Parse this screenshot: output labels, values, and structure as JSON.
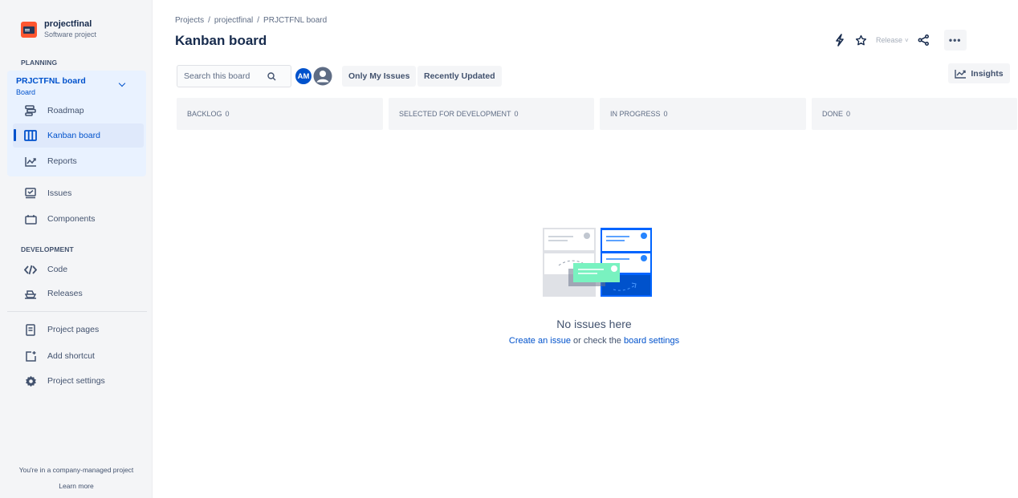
{
  "project": {
    "name": "projectfinal",
    "type": "Software project"
  },
  "sidebar": {
    "planning_label": "PLANNING",
    "board": {
      "title": "PRJCTFNL board",
      "subtitle": "Board"
    },
    "board_items": [
      {
        "label": "Roadmap",
        "icon": "roadmap-icon"
      },
      {
        "label": "Kanban board",
        "icon": "kanban-board-icon",
        "active": true
      },
      {
        "label": "Reports",
        "icon": "reports-icon"
      }
    ],
    "items": [
      {
        "label": "Issues",
        "icon": "issues-icon"
      },
      {
        "label": "Components",
        "icon": "components-icon"
      }
    ],
    "development_label": "DEVELOPMENT",
    "dev_items": [
      {
        "label": "Code",
        "icon": "code-icon"
      },
      {
        "label": "Releases",
        "icon": "releases-icon"
      }
    ],
    "bottom_items": [
      {
        "label": "Project pages",
        "icon": "project-pages-icon"
      },
      {
        "label": "Add shortcut",
        "icon": "add-shortcut-icon"
      },
      {
        "label": "Project settings",
        "icon": "gear-icon"
      }
    ],
    "footer": {
      "text": "You're in a company-managed project",
      "link": "Learn more"
    }
  },
  "breadcrumb": [
    "Projects",
    "/",
    "projectfinal",
    "/",
    "PRJCTFNL board"
  ],
  "page_title": "Kanban board",
  "header": {
    "release_label": "Release"
  },
  "toolbar": {
    "search_placeholder": "Search this board",
    "avatar_initials": "AM",
    "filters": [
      "Only My Issues",
      "Recently Updated"
    ],
    "insights_label": "Insights"
  },
  "columns": [
    {
      "name": "BACKLOG",
      "count": "0"
    },
    {
      "name": "SELECTED FOR DEVELOPMENT",
      "count": "0"
    },
    {
      "name": "IN PROGRESS",
      "count": "0"
    },
    {
      "name": "DONE",
      "count": "0"
    }
  ],
  "empty_state": {
    "title": "No issues here",
    "create_link": "Create an issue",
    "middle_text": " or check the ",
    "settings_link": "board settings"
  },
  "colors": {
    "accent": "#0052cc",
    "sidebar_bg": "#f4f5f7",
    "active_bg": "#dfe9fb"
  }
}
